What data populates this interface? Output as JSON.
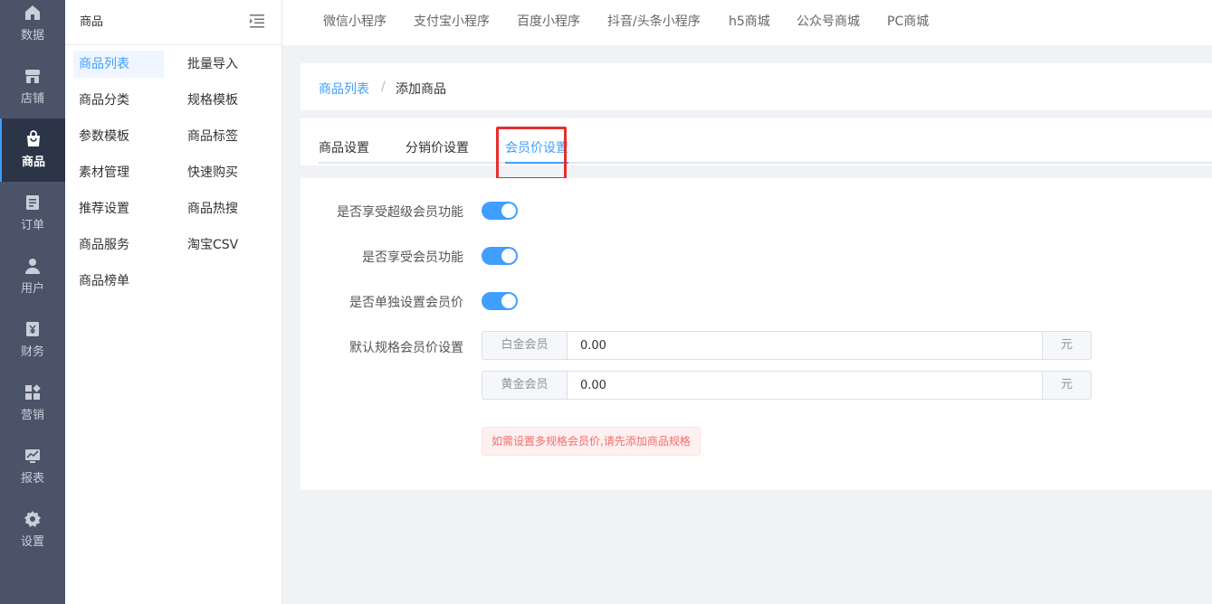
{
  "nav": {
    "items": [
      {
        "label": "数据",
        "icon": "home-icon"
      },
      {
        "label": "店铺",
        "icon": "store-icon"
      },
      {
        "label": "商品",
        "icon": "shopping-bag-icon"
      },
      {
        "label": "订单",
        "icon": "order-icon"
      },
      {
        "label": "用户",
        "icon": "user-icon"
      },
      {
        "label": "财务",
        "icon": "finance-icon"
      },
      {
        "label": "营销",
        "icon": "marketing-icon"
      },
      {
        "label": "报表",
        "icon": "report-icon"
      },
      {
        "label": "设置",
        "icon": "gear-icon"
      }
    ],
    "active_index": 2
  },
  "submenu": {
    "title": "商品",
    "col1": [
      "商品列表",
      "商品分类",
      "参数模板",
      "素材管理",
      "推荐设置",
      "商品服务",
      "商品榜单"
    ],
    "col2": [
      "批量导入",
      "规格模板",
      "商品标签",
      "快速购买",
      "商品热搜",
      "淘宝CSV"
    ],
    "active": "商品列表"
  },
  "top_tabs": [
    "微信小程序",
    "支付宝小程序",
    "百度小程序",
    "抖音/头条小程序",
    "h5商城",
    "公众号商城",
    "PC商城"
  ],
  "breadcrumb": {
    "parent": "商品列表",
    "separator": "/",
    "current": "添加商品"
  },
  "tabs": [
    {
      "label": "商品设置",
      "active": false
    },
    {
      "label": "分销价设置",
      "active": false
    },
    {
      "label": "会员价设置",
      "active": true
    }
  ],
  "form": {
    "switches": [
      {
        "label": "是否享受超级会员功能",
        "on": true
      },
      {
        "label": "是否享受会员功能",
        "on": true
      },
      {
        "label": "是否单独设置会员价",
        "on": true
      }
    ],
    "price_label": "默认规格会员价设置",
    "prices": [
      {
        "prefix": "白金会员",
        "value": "0.00",
        "suffix": "元"
      },
      {
        "prefix": "黄金会员",
        "value": "0.00",
        "suffix": "元"
      }
    ],
    "tip": "如需设置多规格会员价,请先添加商品规格"
  },
  "colors": {
    "accent": "#409eff",
    "nav_bg": "#4a5368",
    "highlight": "#e82d2d",
    "tip_text": "#f56c6c"
  }
}
